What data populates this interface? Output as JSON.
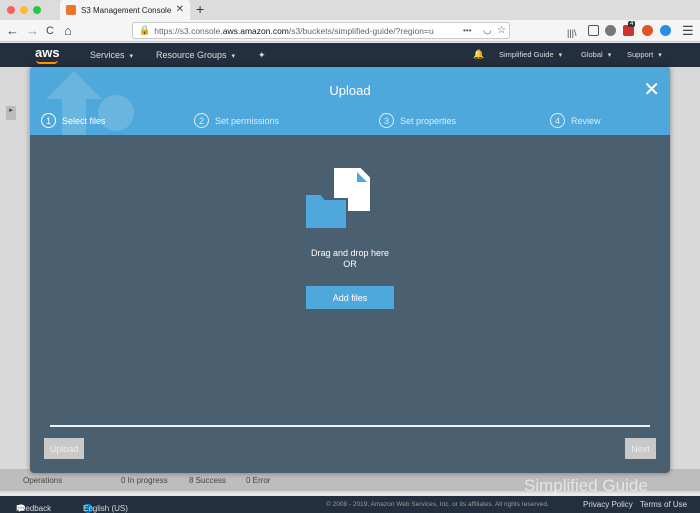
{
  "browser": {
    "tab_title": "S3 Management Console",
    "tab_close": "✕",
    "new_tab": "+",
    "url_prefix": "https://s3.console.",
    "url_domain": "aws.amazon.com",
    "url_suffix": "/s3/buckets/simplified-guide/?region=u",
    "more_glyph": "•••",
    "back_glyph": "←",
    "forward_glyph": "→",
    "reload_glyph": "C",
    "home_glyph": "⌂",
    "star_glyph": "☆",
    "pocket_glyph": "◡",
    "library_glyph": "|||\\",
    "menu_glyph": "☰",
    "badge_count": "4"
  },
  "aws_header": {
    "logo": "aws",
    "services": "Services",
    "resource_groups": "Resource Groups",
    "pin_glyph": "✦",
    "bell_glyph": "🔔",
    "account": "Simplified Guide",
    "region": "Global",
    "support": "Support",
    "dropdown_glyph": "▾"
  },
  "modal": {
    "title": "Upload",
    "close_glyph": "✕",
    "steps": [
      {
        "num": "1",
        "label": "Select files"
      },
      {
        "num": "2",
        "label": "Set permissions"
      },
      {
        "num": "3",
        "label": "Set properties"
      },
      {
        "num": "4",
        "label": "Review"
      }
    ],
    "drop_line1": "Drag and drop here",
    "drop_line2": "OR",
    "add_files": "Add files",
    "upload": "Upload",
    "next": "Next"
  },
  "status_bar": {
    "operations": "Operations",
    "in_progress": "0 In progress",
    "success": "8 Success",
    "error": "0 Error"
  },
  "footer": {
    "feedback": "Feedback",
    "language": "English (US)",
    "copyright": "© 2008 - 2019, Amazon Web Services, Inc. or its affiliates. All rights reserved.",
    "privacy": "Privacy Policy",
    "terms": "Terms of Use"
  },
  "side_toggle": "▸",
  "watermark": "Simplified Guide",
  "colors": {
    "accent": "#4fa8db",
    "modal_body": "#4a5f70",
    "aws_header": "#232f3e",
    "aws_orange": "#ff9900"
  }
}
